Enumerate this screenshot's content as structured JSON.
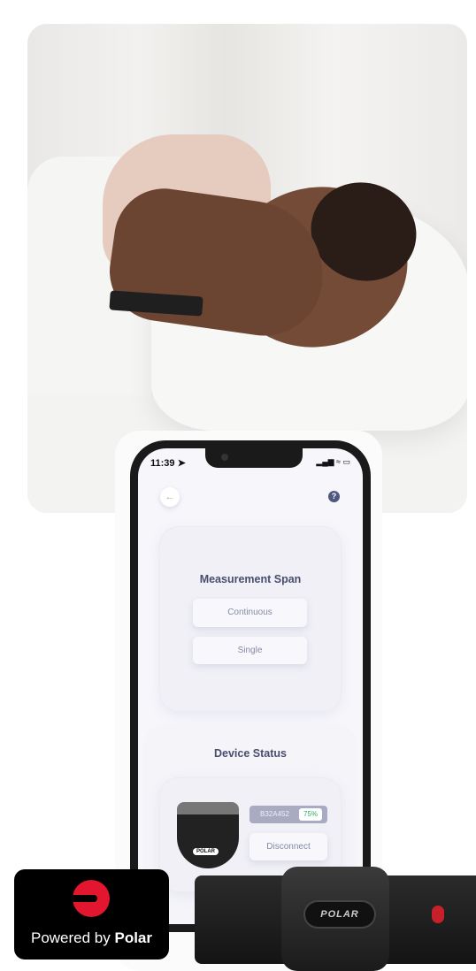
{
  "status_bar": {
    "time": "11:39 ➤",
    "indicators": "▂▄▆ ≈ ▭"
  },
  "nav": {
    "back_icon": "←",
    "help_icon": "?"
  },
  "measurement": {
    "title": "Measurement Span",
    "options": [
      "Continuous",
      "Single"
    ]
  },
  "device": {
    "title": "Device Status",
    "id": "B32A452",
    "battery": "75%",
    "disconnect_label": "Disconnect",
    "device_logo": "POLAR"
  },
  "badge": {
    "prefix": "Powered by ",
    "brand": "Polar"
  },
  "strap_logo": "POLAR",
  "colors": {
    "accent": "#494e6e",
    "battery": "#2bb06a",
    "polar_red": "#e2162e"
  }
}
